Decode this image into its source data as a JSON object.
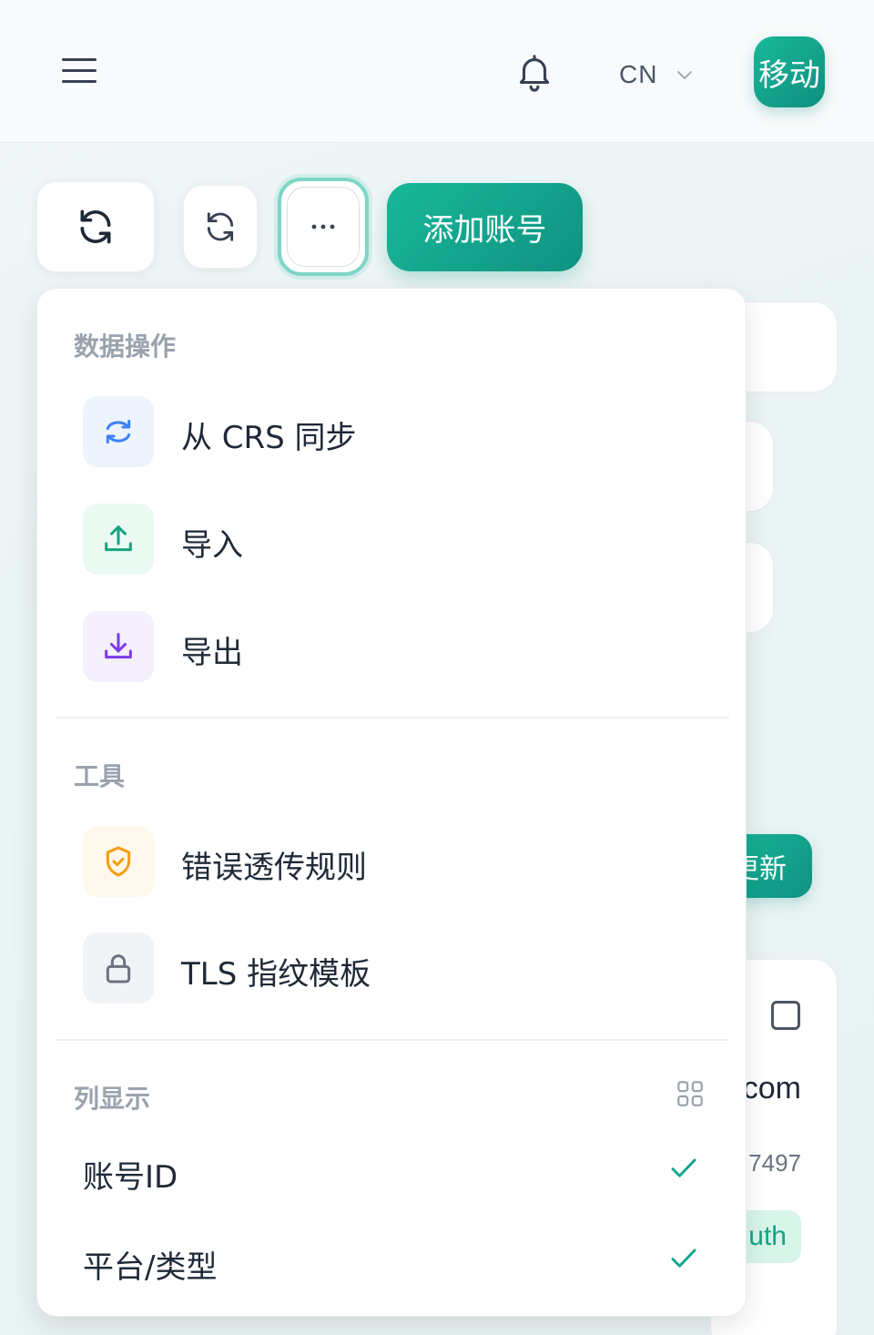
{
  "header": {
    "language": "CN",
    "avatar_text": "移动"
  },
  "toolbar": {
    "add_account_label": "添加账号"
  },
  "background": {
    "update_button_label": "更新",
    "email_fragment": "com",
    "id_fragment": "7497",
    "badge_fragment": "uth"
  },
  "menu": {
    "sections": [
      {
        "title": "数据操作",
        "items": [
          {
            "label": "从 CRS 同步",
            "icon": "sync-icon"
          },
          {
            "label": "导入",
            "icon": "upload-icon"
          },
          {
            "label": "导出",
            "icon": "download-icon"
          }
        ]
      },
      {
        "title": "工具",
        "items": [
          {
            "label": "错误透传规则",
            "icon": "shield-check-icon"
          },
          {
            "label": "TLS 指纹模板",
            "icon": "lock-icon"
          }
        ]
      },
      {
        "title": "列显示",
        "items": [
          {
            "label": "账号ID",
            "checked": true
          },
          {
            "label": "平台/类型",
            "checked": true
          }
        ]
      }
    ]
  },
  "colors": {
    "brand": "#14a58e",
    "sync_icon": "#3b82f6",
    "upload_icon": "#16a37f",
    "download_icon": "#7c3aed",
    "shield_icon": "#f59e0b",
    "lock_icon": "#6b7280"
  }
}
